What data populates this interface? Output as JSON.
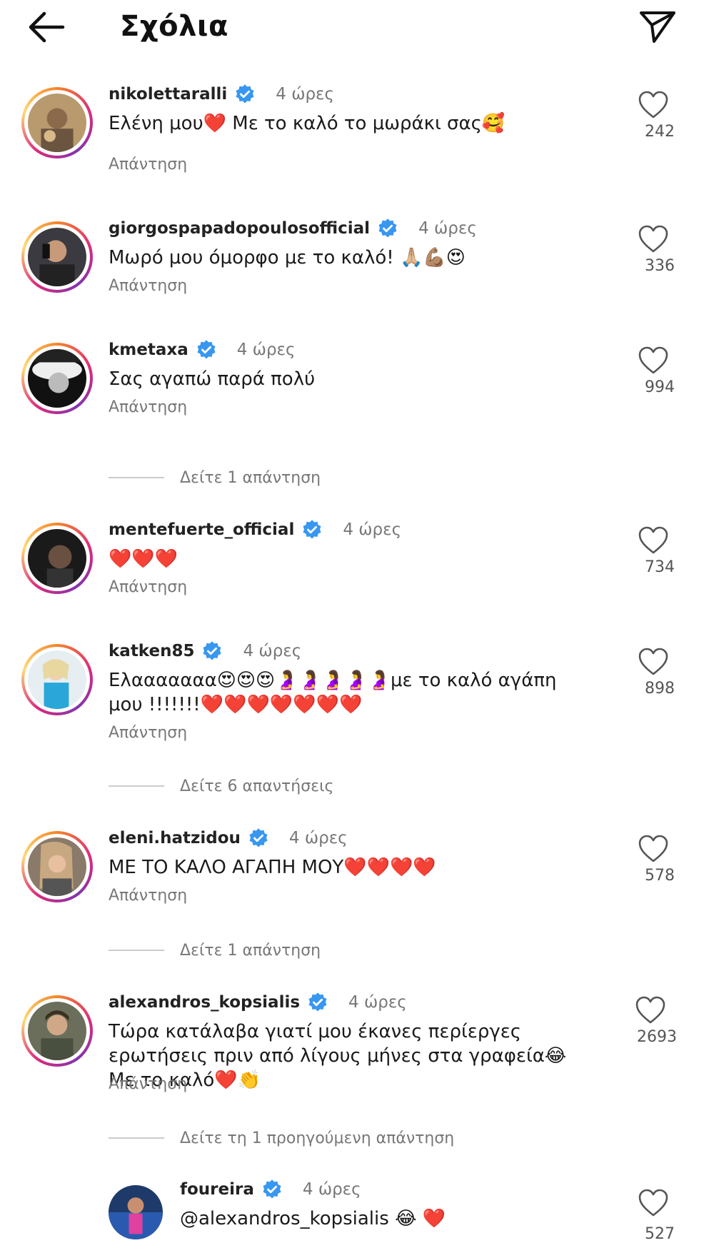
{
  "header": {
    "title": "Σχόλια",
    "back_icon": "arrow-left-icon",
    "share_icon": "paper-plane-icon"
  },
  "reply_label": "Απάντηση",
  "comments": [
    {
      "username": "nikolettaralli",
      "time": "4 ώρες",
      "text": "Ελένη μου❤️ Με το καλό το μωράκι σας🥰",
      "likes": "242"
    },
    {
      "username": "giorgospapadopoulosofficial",
      "time": "4 ώρες",
      "text": "Μωρό μου όμορφο με το καλό! 🙏🏼💪🏽😍",
      "likes": "336"
    },
    {
      "username": "kmetaxa",
      "time": "4 ώρες",
      "text": "Σας αγαπώ παρά πολύ",
      "likes": "994"
    },
    {
      "username": "mentefuerte_official",
      "time": "4 ώρες",
      "text": "❤️❤️❤️",
      "likes": "734"
    },
    {
      "username": "katken85",
      "time": "4 ώρες",
      "text": "Ελααααααα😍😍😍🤰🤰🤰🤰🤰με το καλό αγάπη μου !!!!!!!❤️❤️❤️❤️❤️❤️❤️",
      "likes": "898"
    },
    {
      "username": "eleni.hatzidou",
      "time": "4 ώρες",
      "text": "ΜΕ ΤΟ ΚΑΛΟ ΑΓΑΠΗ ΜΟΥ❤️❤️❤️❤️",
      "likes": "578"
    },
    {
      "username": "alexandros_kopsialis",
      "time": "4 ώρες",
      "text": "Τώρα κατάλαβα γιατί μου έκανες περίεργες ερωτήσεις πριν από λίγους μήνες στα γραφεία😂 Με το καλό❤️👏",
      "likes": "2693"
    },
    {
      "username": "foureira",
      "time": "4 ώρες",
      "text": "@alexandros_kopsialis 😂 ❤️",
      "likes": "527"
    }
  ],
  "view_replies": [
    "Δείτε 1 απάντηση",
    "Δείτε 6 απαντήσεις",
    "Δείτε 1 απάντηση",
    "Δείτε τη 1 προηγούμενη απάντηση"
  ],
  "colors": {
    "verified": "#3897f0",
    "muted": "#777777",
    "ring_start": "#f58529",
    "ring_mid": "#dd2a7b"
  }
}
